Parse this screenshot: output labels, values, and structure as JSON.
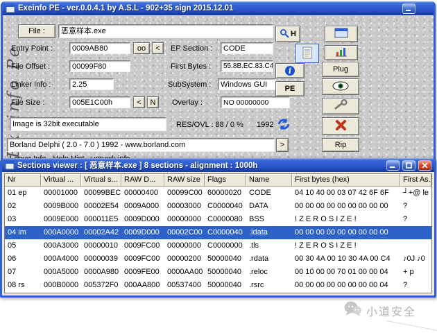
{
  "main_window": {
    "title": "Exeinfo PE - ver.0.0.4.1  by A.S.L -  902+35 sign  2015.12.01",
    "vertical_brand": "Exeinfo Pe",
    "labels": {
      "entry_point": "Entry Point :",
      "file_offset": "File Offset :",
      "linker_info": "Linker Info :",
      "file_size": "File Size :",
      "ep_section": "EP Section :",
      "first_bytes": "First Bytes :",
      "subsystem": "SubSystem :",
      "overlay": "Overlay :",
      "res_ovl": "RES/OVL : 88 / 0 %",
      "year": "1992"
    },
    "values": {
      "file_name": "恶意样本.exe",
      "entry_point": "0009AB80",
      "file_offset": "00099F80",
      "linker_info": "2.25",
      "file_size": "005E1C00h",
      "ep_section": "CODE",
      "first_bytes": "55.8B.EC.83.C4",
      "subsystem": "Windows GUI",
      "overlay": "NO  00000000",
      "image_info": "Image is 32bit executable",
      "detection": "Borland Delphi ( 2.0 - 7.0 ) 1992 - www.borland.com",
      "lamer_info": "Lamer Info - Help Hint -  unpack info"
    },
    "buttons": {
      "file": "File :",
      "oo": "oo",
      "back": "<",
      "size_back": "<",
      "n": "N",
      "h": "H",
      "plug": "Plug",
      "pe": "PE",
      "rip": "Rip",
      "more": ">"
    },
    "icons": {
      "search": "magnifier",
      "notes": "notepad",
      "info": "info-circle",
      "refresh": "refresh-arrows",
      "window": "window",
      "chart": "bar-chart",
      "eye": "eye",
      "wrench": "wrench",
      "close_x": "red-x"
    }
  },
  "sections_window": {
    "title": "Sections viewer :  [ 恶意样本.exe ] 8 sections - alignment : 1000h",
    "columns": [
      "Nr",
      "Virtual ...",
      "Virtual s...",
      "RAW D...",
      "RAW size",
      "Flags",
      "Name",
      "First bytes (hex)",
      "First As..."
    ],
    "rows": [
      {
        "nr": "01 ep",
        "va": "00001000",
        "vs": "00099BEC",
        "rd": "00000400",
        "rs": "00099C00",
        "flags": "60000020",
        "name": "CODE",
        "bytes": "04 10 40 00 03 07 42 6F 6F",
        "asc": "┘+@ le",
        "selected": false
      },
      {
        "nr": "02",
        "va": "0009B000",
        "vs": "00002E54",
        "rd": "0009A000",
        "rs": "00003000",
        "flags": "C0000040",
        "name": "DATA",
        "bytes": "00 00 00 00 00 00 00 00 00",
        "asc": "?",
        "selected": false
      },
      {
        "nr": "03",
        "va": "0009E000",
        "vs": "000011E5",
        "rd": "0009D000",
        "rs": "00000000",
        "flags": "C0000080",
        "name": "BSS",
        "bytes": "! Z E R O   S I Z E !",
        "asc": "?",
        "selected": false
      },
      {
        "nr": "04 im",
        "va": "000A0000",
        "vs": "00002A42",
        "rd": "0009D000",
        "rs": "00002C00",
        "flags": "C0000040",
        "name": ".idata",
        "bytes": "00 00 00 00 00 00 00 00 00",
        "asc": "",
        "selected": true
      },
      {
        "nr": "05",
        "va": "000A3000",
        "vs": "00000010",
        "rd": "0009FC00",
        "rs": "00000000",
        "flags": "C0000000",
        "name": ".tls",
        "bytes": "! Z E R O   S I Z E !",
        "asc": "",
        "selected": false
      },
      {
        "nr": "06",
        "va": "000A4000",
        "vs": "00000039",
        "rd": "0009FC00",
        "rs": "00000200",
        "flags": "50000040",
        "name": ".rdata",
        "bytes": "00 30 4A 00 10 30 4A 00 C4",
        "asc": "♪0J ♪0",
        "selected": false
      },
      {
        "nr": "07",
        "va": "000A5000",
        "vs": "0000A980",
        "rd": "0009FE00",
        "rs": "0000AA00",
        "flags": "50000040",
        "name": ".reloc",
        "bytes": "00 10 00 00 70 01 00 00 04",
        "asc": "+  p",
        "selected": false
      },
      {
        "nr": "08 rs",
        "va": "000B0000",
        "vs": "005372F0",
        "rd": "000AA800",
        "rs": "00537400",
        "flags": "50000040",
        "name": ".rsrc",
        "bytes": "00 00 00 00 00 00 00 00 04",
        "asc": "?",
        "selected": false
      }
    ]
  },
  "watermark": {
    "text": "小道安全"
  },
  "colors": {
    "titlebar_blue": "#2a57cc",
    "selection_blue": "#2d63c8",
    "close_red": "#c0341a",
    "accent_blue": "#1e5ad8"
  }
}
